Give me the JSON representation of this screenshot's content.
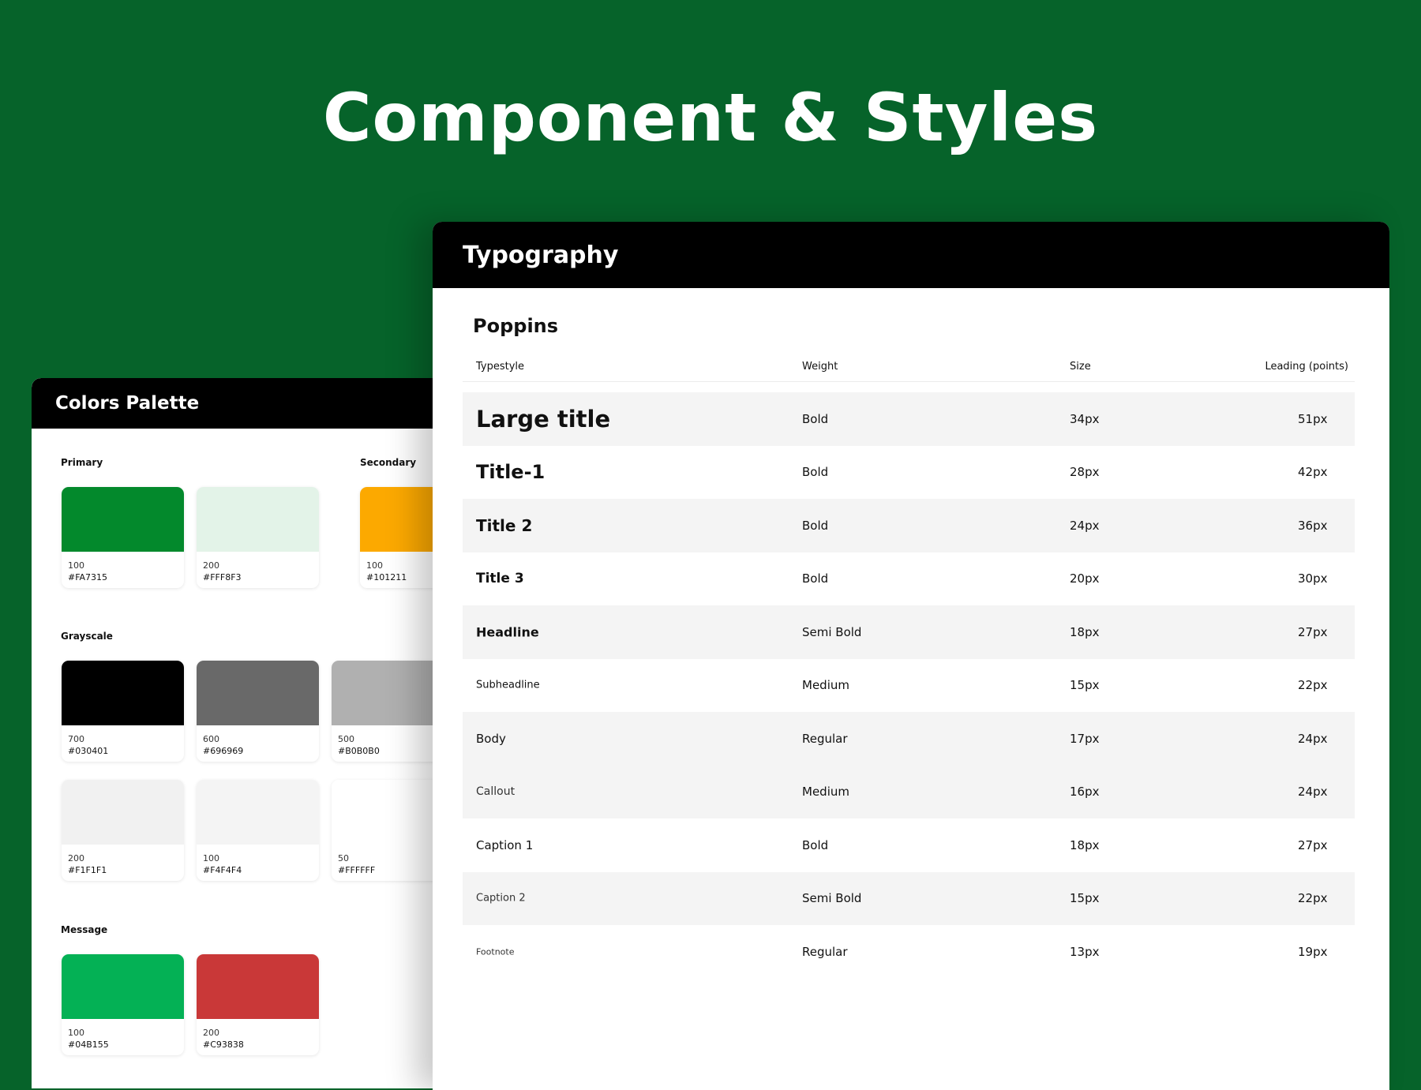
{
  "page": {
    "title": "Component & Styles"
  },
  "palette": {
    "title": "Colors Palette",
    "sections": {
      "primary": "Primary",
      "secondary": "Secondary",
      "grayscale": "Grayscale",
      "message": "Message"
    },
    "swatches": [
      {
        "shade": "100",
        "hex": "#FA7315",
        "color": "#03892c"
      },
      {
        "shade": "200",
        "hex": "#FFF8F3",
        "color": "#e3f3e8"
      },
      {
        "shade": "100",
        "hex": "#101211",
        "color": "#fca900"
      },
      {
        "shade": "700",
        "hex": "#030401",
        "color": "#000000"
      },
      {
        "shade": "600",
        "hex": "#696969",
        "color": "#696969"
      },
      {
        "shade": "500",
        "hex": "#B0B0B0",
        "color": "#b0b0b0"
      },
      {
        "shade": "200",
        "hex": "#F1F1F1",
        "color": "#f1f1f1"
      },
      {
        "shade": "100",
        "hex": "#F4F4F4",
        "color": "#f4f4f4"
      },
      {
        "shade": "50",
        "hex": "#FFFFFF",
        "color": "#ffffff"
      },
      {
        "shade": "100",
        "hex": "#04B155",
        "color": "#04b155"
      },
      {
        "shade": "200",
        "hex": "#C93838",
        "color": "#c93838"
      }
    ]
  },
  "typography": {
    "title": "Typography",
    "font": "Poppins",
    "columns": {
      "typestyle": "Typestyle",
      "weight": "Weight",
      "size": "Size",
      "leading": "Leading (points)"
    },
    "rows": [
      {
        "style": "Large title",
        "weight": "Bold",
        "size": "34px",
        "leading": "51px"
      },
      {
        "style": "Title-1",
        "weight": "Bold",
        "size": "28px",
        "leading": "42px"
      },
      {
        "style": "Title 2",
        "weight": "Bold",
        "size": "24px",
        "leading": "36px"
      },
      {
        "style": "Title 3",
        "weight": "Bold",
        "size": "20px",
        "leading": "30px"
      },
      {
        "style": "Headline",
        "weight": "Semi Bold",
        "size": "18px",
        "leading": "27px"
      },
      {
        "style": "Subheadline",
        "weight": "Medium",
        "size": "15px",
        "leading": "22px"
      },
      {
        "style": "Body",
        "weight": "Regular",
        "size": "17px",
        "leading": "24px"
      },
      {
        "style": "Callout",
        "weight": "Medium",
        "size": "16px",
        "leading": "24px"
      },
      {
        "style": "Caption 1",
        "weight": "Bold",
        "size": "18px",
        "leading": "27px"
      },
      {
        "style": "Caption 2",
        "weight": "Semi Bold",
        "size": "15px",
        "leading": "22px"
      },
      {
        "style": "Footnote",
        "weight": "Regular",
        "size": "13px",
        "leading": "19px"
      }
    ]
  }
}
